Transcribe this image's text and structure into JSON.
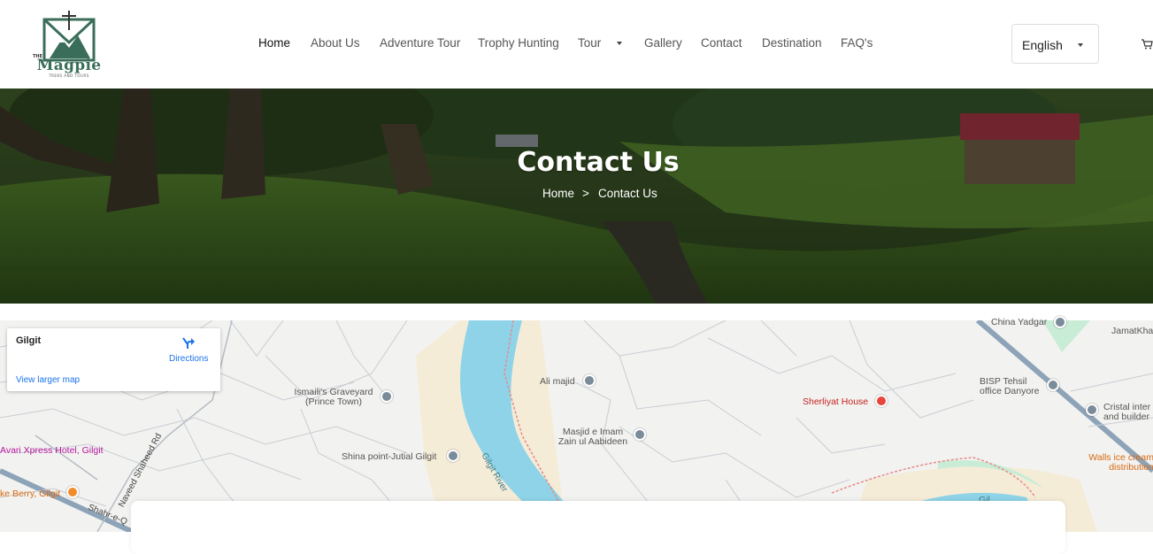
{
  "brand": {
    "the_label": "THE",
    "name": "Magpie",
    "tagline": "TREKS AND TOURS",
    "colors": {
      "primary": "#3b6e5a"
    }
  },
  "nav": {
    "items": [
      {
        "label": "Home"
      },
      {
        "label": "About Us"
      },
      {
        "label": "Adventure Tour"
      },
      {
        "label": "Trophy Hunting"
      },
      {
        "label": "Tour"
      },
      {
        "label": "Gallery"
      },
      {
        "label": "Contact"
      },
      {
        "label": "Destination"
      },
      {
        "label": "FAQ's"
      }
    ]
  },
  "language": {
    "selected": "English"
  },
  "cart": {
    "icon": "cart-icon"
  },
  "hero": {
    "title": "Contact Us",
    "breadcrumb": {
      "home": "Home",
      "separator": ">",
      "current": "Contact Us"
    }
  },
  "map": {
    "card": {
      "title": "Gilgit",
      "directions": "Directions",
      "view_larger": "View larger map"
    },
    "pois": {
      "china_yadgar": "China Yadgar",
      "jamatkhana": "JamatKha",
      "ali_majid": "Ali majid",
      "ismailis_graveyard_1": "Ismaili's Graveyard",
      "ismailis_graveyard_2": "(Prince Town)",
      "bisp_1": "BISP Tehsil",
      "bisp_2": "office Danyore",
      "sherliyat": "Sherliyat House",
      "masjid_1": "Masjid e Imam",
      "masjid_2": "Zain ul Aabideen",
      "cristal_1": "Cristal inter",
      "cristal_2": "and builder",
      "avari": "Avari Xpress Hotel, Gilgit",
      "shina": "Shina point-Jutial Gilgit",
      "walls_1": "Walls ice cream",
      "walls_2": "distribution",
      "berry": "ke Berry, Gilgit",
      "naveed_rd": "Naveed Shaheed Rd",
      "shahre": "Shahr-e-Q",
      "gilgit_river": "Gilgit River",
      "lake_label": "Gil"
    }
  }
}
